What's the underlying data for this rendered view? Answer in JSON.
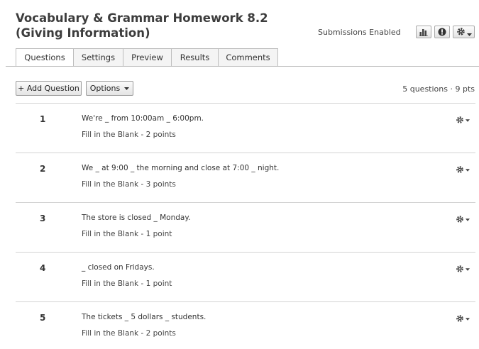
{
  "header": {
    "title": "Vocabulary & Grammar Homework 8.2 (Giving Information)",
    "status": "Submissions Enabled",
    "icon_buttons": [
      "bar-chart-icon",
      "info-icon",
      "gear-icon"
    ]
  },
  "tabs": [
    {
      "label": "Questions",
      "active": true
    },
    {
      "label": "Settings",
      "active": false
    },
    {
      "label": "Preview",
      "active": false
    },
    {
      "label": "Results",
      "active": false
    },
    {
      "label": "Comments",
      "active": false
    }
  ],
  "toolbar": {
    "add_question_label": "+ Add Question",
    "options_label": "Options",
    "summary": "5 questions · 9 pts"
  },
  "questions": [
    {
      "number": "1",
      "text": "We're _ from 10:00am _ 6:00pm.",
      "type": "Fill in the Blank - 2 points"
    },
    {
      "number": "2",
      "text": "We _ at 9:00 _ the morning and close at 7:00 _ night.",
      "type": "Fill in the Blank - 3 points"
    },
    {
      "number": "3",
      "text": "The store is closed _ Monday.",
      "type": "Fill in the Blank - 1 point"
    },
    {
      "number": "4",
      "text": "_ closed on Fridays.",
      "type": "Fill in the Blank - 1 point"
    },
    {
      "number": "5",
      "text": "The tickets _ 5 dollars _ students.",
      "type": "Fill in the Blank - 2 points"
    }
  ]
}
